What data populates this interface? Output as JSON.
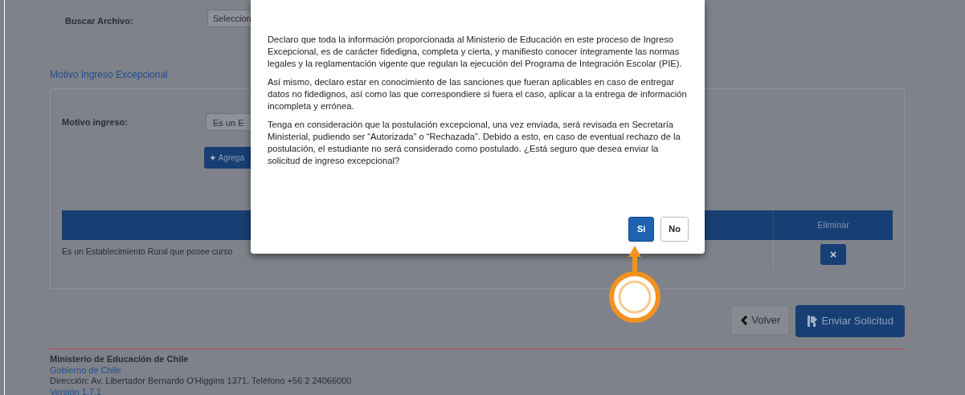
{
  "form": {
    "file_label": "Buscar Archivo:",
    "file_button": "Seleccion",
    "section_title": "Motivo Ingreso Excepcional",
    "reason_label": "Motivo ingreso:",
    "reason_value": "Es un E",
    "add_button": "Agrega"
  },
  "table": {
    "columns": [
      "",
      "Eliminar"
    ],
    "rows": [
      {
        "reason": "Es un Establecimiento Rural que posee curso",
        "delete": "×"
      }
    ]
  },
  "actions": [
    {
      "label": "Volver",
      "kind": "back"
    },
    {
      "label": "Enviar Solicitud",
      "kind": "send"
    }
  ],
  "footer": {
    "org": "Ministerio de Educación de Chile",
    "link": "Gobierno de Chile",
    "address": "Dirección: Av. Libertador Bernardo O'Higgins 1371. Teléfono +56 2 24066000",
    "version": "Versión 1.7.1"
  },
  "dialog": {
    "paragraphs": [
      "Declaro que toda la información proporcionada al Ministerio de Educación en este proceso de Ingreso Excepcional, es de carácter fidedigna, completa y cierta, y manifiesto conocer íntegramente las normas legales y la reglamentación vigente que regulan la ejecución del Programa de Integración Escolar (PIE).",
      "Así mismo, declaro estar en conocimiento de las sanciones que fueran aplicables en caso de entregar datos no fidedignos, así como las que correspondiere si fuera el caso, aplicar a la entrega de información incompleta y errónea.",
      "Tenga en consideración que la postulación excepcional, una vez enviada, será revisada en Secretaría Ministerial, pudiendo ser “Autorizada” o “Rechazada”. Debido a esto, en caso de eventual rechazo de la postulación, el estudiante no será considerado como postulado. ¿Está seguro que desea enviar la solicitud de ingreso excepcional?"
    ],
    "buttons": [
      {
        "label": "Si",
        "kind": "primary"
      },
      {
        "label": "No",
        "kind": "default"
      }
    ]
  }
}
